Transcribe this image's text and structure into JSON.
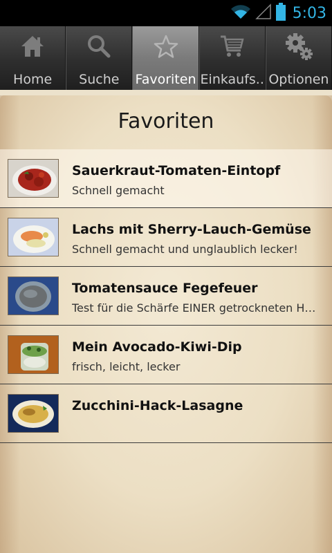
{
  "status_bar": {
    "time": "5:03",
    "icons": [
      "wifi-icon",
      "signal-icon",
      "battery-icon"
    ]
  },
  "tabs": [
    {
      "label": "Home",
      "icon": "home-icon",
      "active": false
    },
    {
      "label": "Suche",
      "icon": "search-icon",
      "active": false
    },
    {
      "label": "Favoriten",
      "icon": "star-icon",
      "active": true
    },
    {
      "label": "Einkaufs..",
      "icon": "cart-icon",
      "active": false
    },
    {
      "label": "Optionen",
      "icon": "gear-icon",
      "active": false
    }
  ],
  "page": {
    "title": "Favoriten"
  },
  "recipes": [
    {
      "title": "Sauerkraut-Tomaten-Eintopf",
      "subtitle": "Schnell gemacht",
      "thumb": "stew-photo"
    },
    {
      "title": "Lachs mit Sherry-Lauch-Gemüse",
      "subtitle": "Schnell gemacht und unglaublich lecker!",
      "thumb": "salmon-photo"
    },
    {
      "title": "Tomatensauce Fegefeuer",
      "subtitle": "Test für die Schärfe EINER getrockneten Ha…",
      "thumb": "sauce-photo"
    },
    {
      "title": "Mein Avocado-Kiwi-Dip",
      "subtitle": "frisch, leicht, lecker",
      "thumb": "dip-photo"
    },
    {
      "title": "Zucchini-Hack-Lasagne",
      "subtitle": "",
      "thumb": "lasagne-photo"
    }
  ],
  "colors": {
    "status_time": "#33b5e5",
    "active_tab": "#7b7b7b",
    "parchment": "#ecdfc4"
  }
}
